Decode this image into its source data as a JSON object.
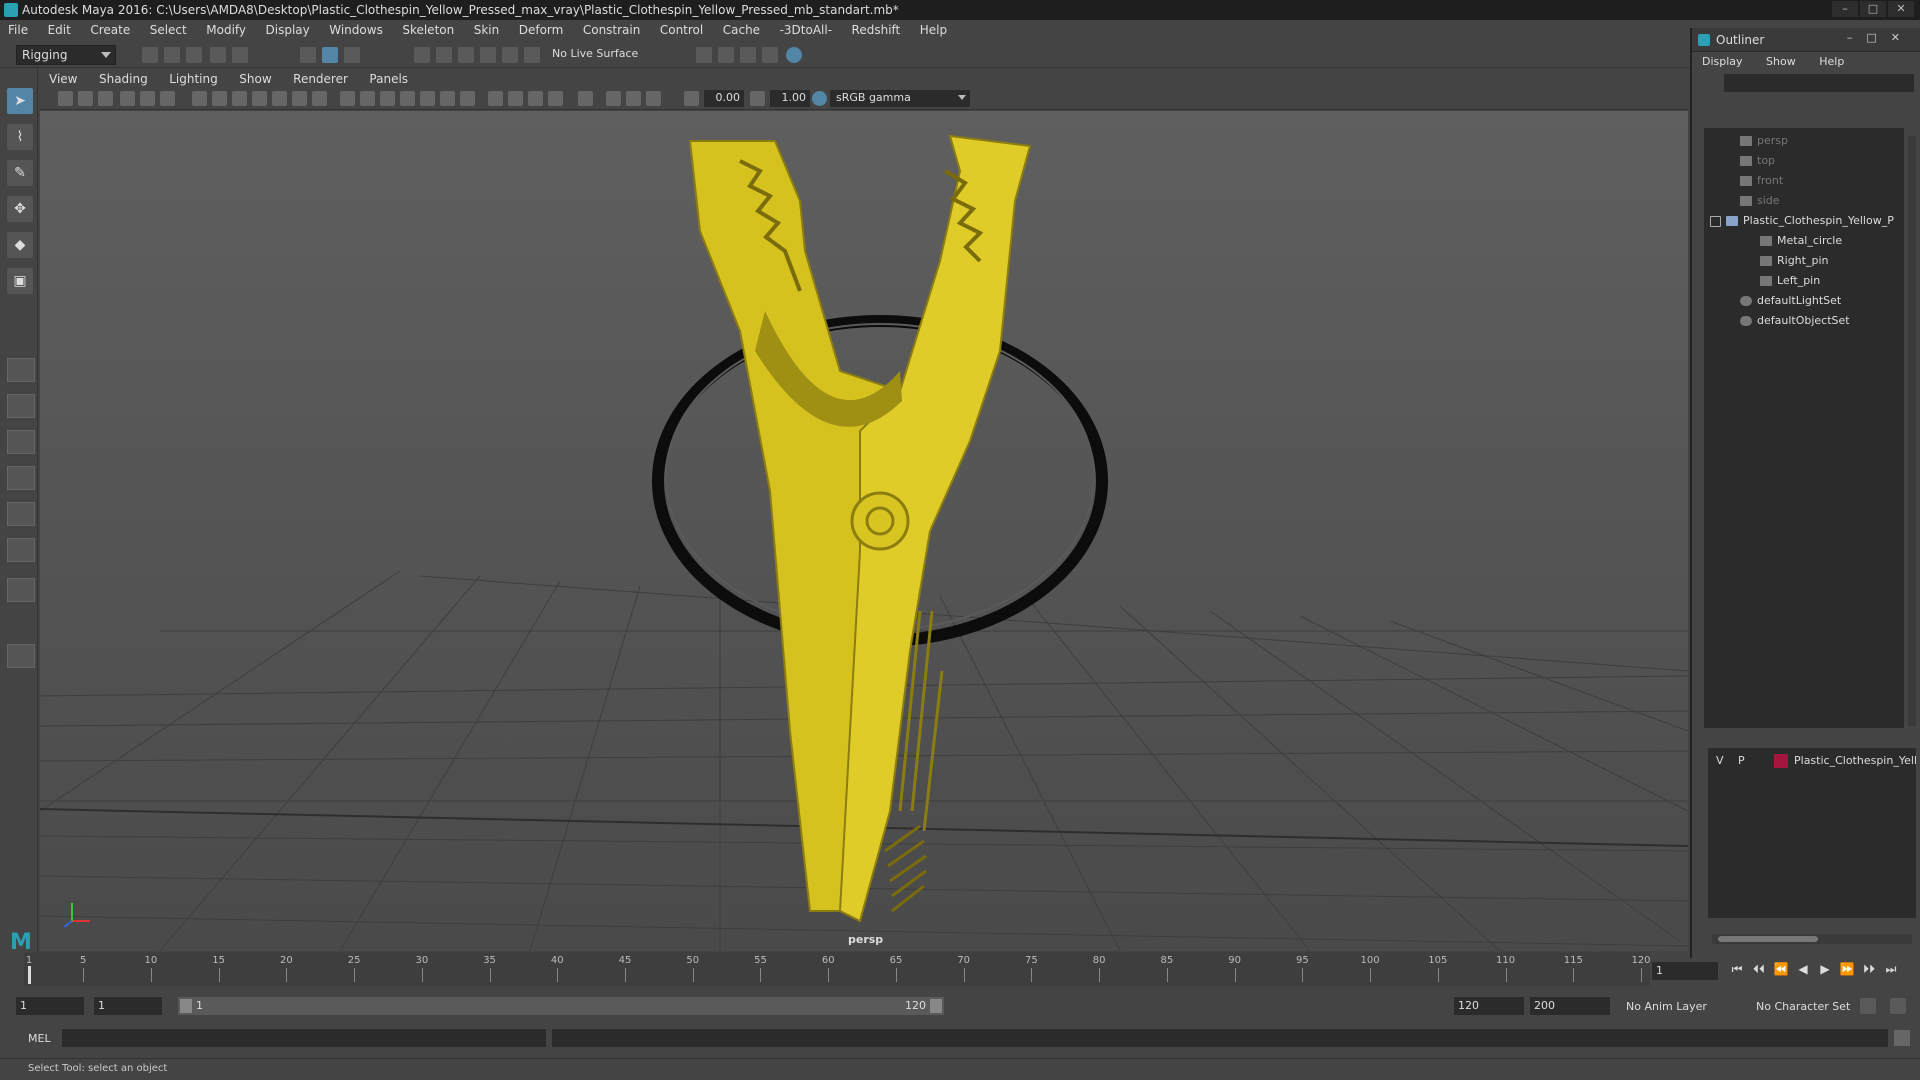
{
  "window": {
    "title": "Autodesk Maya 2016: C:\\Users\\AMDA8\\Desktop\\Plastic_Clothespin_Yellow_Pressed_max_vray\\Plastic_Clothespin_Yellow_Pressed_mb_standart.mb*",
    "min": "–",
    "max": "□",
    "close": "✕"
  },
  "menubar": [
    "File",
    "Edit",
    "Create",
    "Select",
    "Modify",
    "Display",
    "Windows",
    "Skeleton",
    "Skin",
    "Deform",
    "Constrain",
    "Control",
    "Cache",
    "-3DtoAll-",
    "Redshift",
    "Help"
  ],
  "statusline": {
    "mode": "Rigging",
    "live_surface": "No Live Surface"
  },
  "panel_menu": [
    "View",
    "Shading",
    "Lighting",
    "Show",
    "Renderer",
    "Panels"
  ],
  "panel_toolbar": {
    "exposure": "0.00",
    "gamma_value": "1.00",
    "color_space": "sRGB gamma"
  },
  "viewport": {
    "camera": "persp"
  },
  "outliner": {
    "title": "Outliner",
    "menu": [
      "Display",
      "Show",
      "Help"
    ],
    "items": [
      {
        "label": "persp",
        "dim": true
      },
      {
        "label": "top",
        "dim": true
      },
      {
        "label": "front",
        "dim": true
      },
      {
        "label": "side",
        "dim": true
      },
      {
        "label": "Plastic_Clothespin_Yellow_P",
        "dim": false
      },
      {
        "label": "Metal_circle",
        "dim": false
      },
      {
        "label": "Right_pin",
        "dim": false
      },
      {
        "label": "Left_pin",
        "dim": false
      },
      {
        "label": "defaultLightSet",
        "dim": false
      },
      {
        "label": "defaultObjectSet",
        "dim": false
      }
    ]
  },
  "layer_editor": {
    "v": "V",
    "p": "P",
    "layer_name": "Plastic_Clothespin_Yell",
    "layer_color": "#a4163e"
  },
  "timeslider": {
    "ticks": [
      "5",
      "10",
      "15",
      "20",
      "25",
      "30",
      "35",
      "40",
      "45",
      "50",
      "55",
      "60",
      "65",
      "70",
      "75",
      "80",
      "85",
      "90",
      "95",
      "100",
      "105",
      "110",
      "115",
      "120"
    ],
    "start_tick": "1",
    "current_frame": "1"
  },
  "playback_buttons": [
    "⏮",
    "⏴⏴",
    "⏪",
    "◀",
    "▶",
    "⏩",
    "⏵⏵",
    "⏭"
  ],
  "range": {
    "start": "1",
    "start2": "1",
    "range_start": "1",
    "range_end": "120",
    "end": "120",
    "end2": "200",
    "anim_layer": "No Anim Layer",
    "char_set": "No Character Set"
  },
  "cmdline": {
    "label": "MEL"
  },
  "helpline": {
    "text": "Select Tool: select an object"
  },
  "colors": {
    "clothespin": "#d9c424",
    "ring": "#111111",
    "accent": "#5285a6"
  }
}
